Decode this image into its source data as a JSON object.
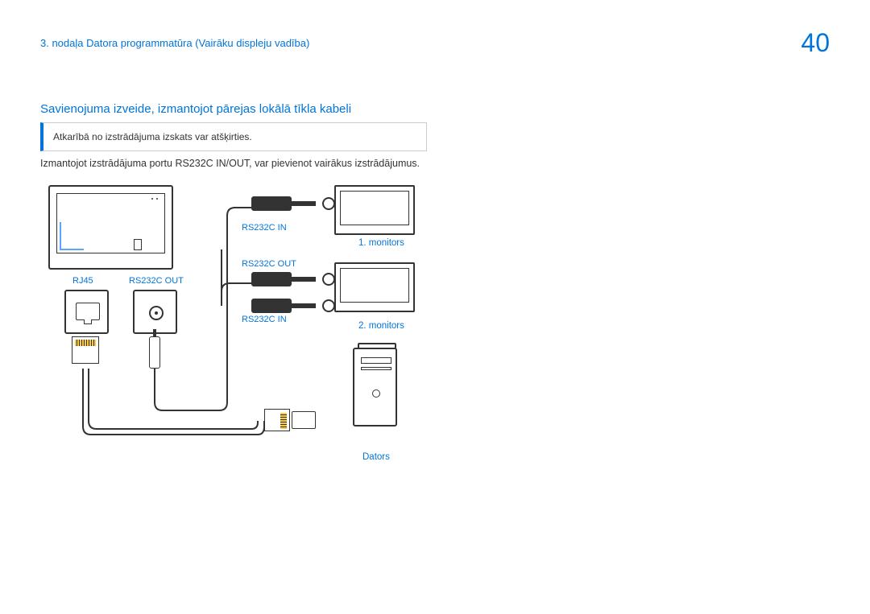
{
  "header": {
    "breadcrumb": "3. nodaļa Datora programmatūra (Vairāku displeju vadība)",
    "pageNumber": "40"
  },
  "section": {
    "title": "Savienojuma izveide, izmantojot pārejas lokālā tīkla kabeli",
    "note": "Atkarībā no izstrādājuma izskats var atšķirties.",
    "body": "Izmantojot izstrādājuma portu RS232C IN/OUT, var pievienot vairākus izstrādājumus."
  },
  "labels": {
    "rj45": "RJ45",
    "rs232cOut": "RS232C OUT",
    "rs232cIn": "RS232C IN",
    "monitor1": "1. monitors",
    "monitor2": "2. monitors",
    "dators": "Dators"
  }
}
